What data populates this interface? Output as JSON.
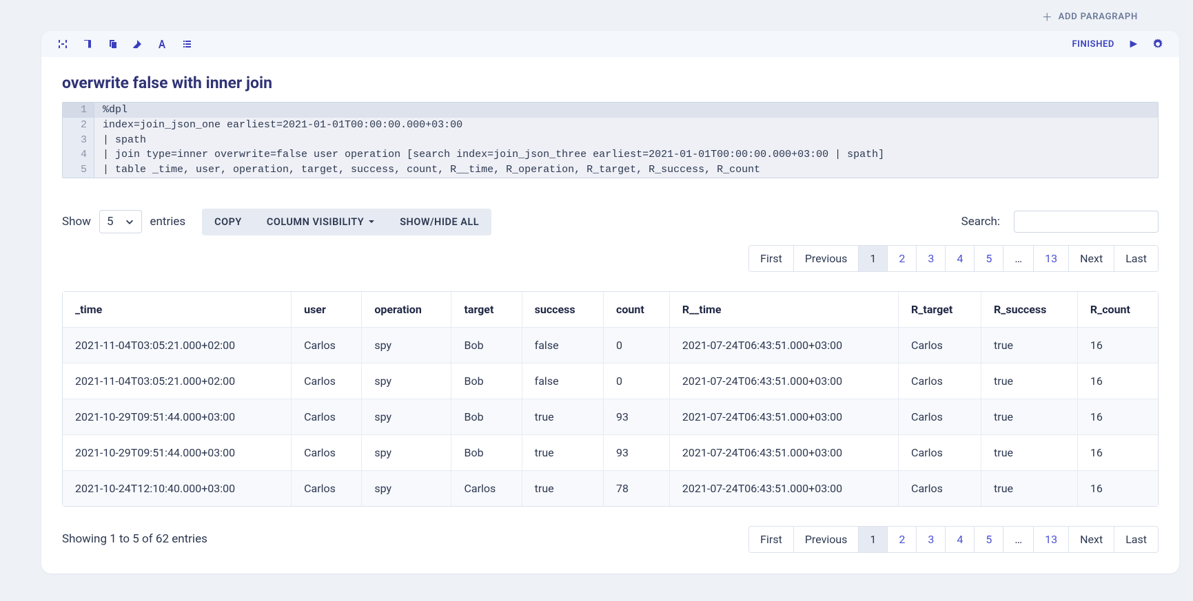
{
  "add_paragraph_label": "ADD PARAGRAPH",
  "status_label": "FINISHED",
  "paragraph_title": "overwrite false with inner join",
  "code": {
    "lines": [
      "%dpl",
      "index=join_json_one earliest=2021-01-01T00:00:00.000+03:00",
      "| spath",
      "| join type=inner overwrite=false user operation [search index=join_json_three earliest=2021-01-01T00:00:00.000+03:00 | spath]",
      "| table _time, user, operation, target, success, count, R__time, R_operation, R_target, R_success, R_count"
    ]
  },
  "controls": {
    "show_label": "Show",
    "page_size": "5",
    "entries_label": "entries",
    "copy_label": "COPY",
    "colvis_label": "COLUMN VISIBILITY",
    "showhide_label": "SHOW/HIDE ALL",
    "search_label": "Search:",
    "search_value": ""
  },
  "pager": {
    "first": "First",
    "previous": "Previous",
    "pages": [
      "1",
      "2",
      "3",
      "4",
      "5"
    ],
    "ellipsis": "…",
    "last_page": "13",
    "next": "Next",
    "last": "Last",
    "active_index": 0
  },
  "table": {
    "columns": [
      "_time",
      "user",
      "operation",
      "target",
      "success",
      "count",
      "R__time",
      "R_target",
      "R_success",
      "R_count"
    ],
    "rows": [
      [
        "2021-11-04T03:05:21.000+02:00",
        "Carlos",
        "spy",
        "Bob",
        "false",
        "0",
        "2021-07-24T06:43:51.000+03:00",
        "Carlos",
        "true",
        "16"
      ],
      [
        "2021-11-04T03:05:21.000+02:00",
        "Carlos",
        "spy",
        "Bob",
        "false",
        "0",
        "2021-07-24T06:43:51.000+03:00",
        "Carlos",
        "true",
        "16"
      ],
      [
        "2021-10-29T09:51:44.000+03:00",
        "Carlos",
        "spy",
        "Bob",
        "true",
        "93",
        "2021-07-24T06:43:51.000+03:00",
        "Carlos",
        "true",
        "16"
      ],
      [
        "2021-10-29T09:51:44.000+03:00",
        "Carlos",
        "spy",
        "Bob",
        "true",
        "93",
        "2021-07-24T06:43:51.000+03:00",
        "Carlos",
        "true",
        "16"
      ],
      [
        "2021-10-24T12:10:40.000+03:00",
        "Carlos",
        "spy",
        "Carlos",
        "true",
        "78",
        "2021-07-24T06:43:51.000+03:00",
        "Carlos",
        "true",
        "16"
      ]
    ]
  },
  "info_text": "Showing 1 to 5 of 62 entries"
}
